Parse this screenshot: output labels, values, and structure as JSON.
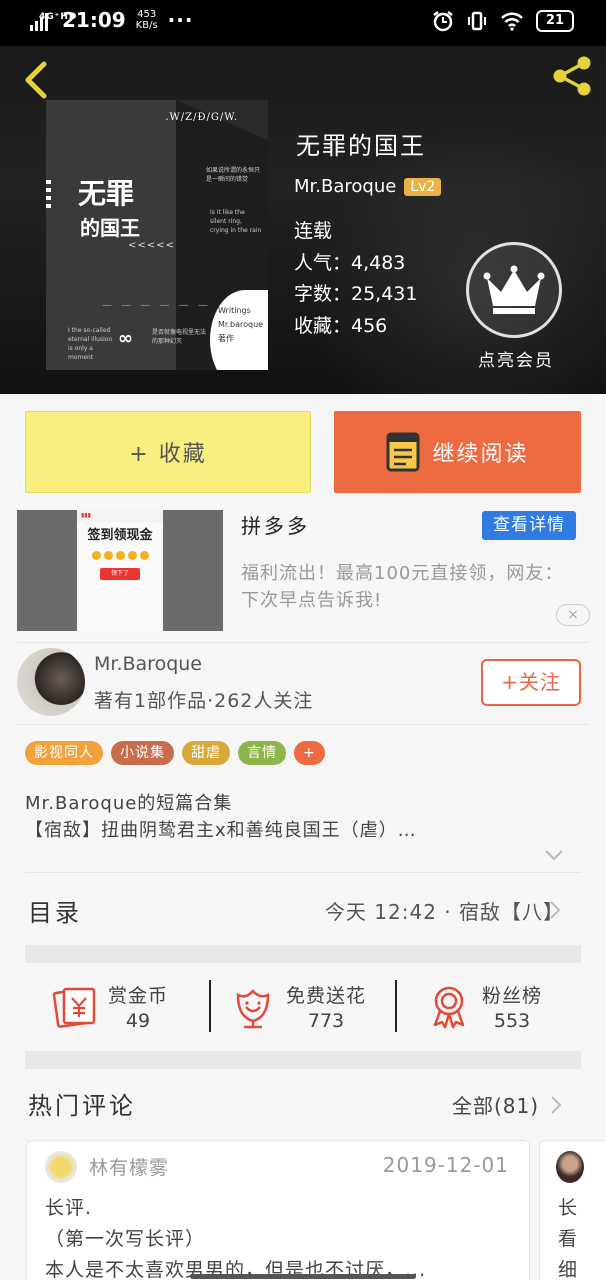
{
  "status_bar": {
    "network": "4G⁺HD",
    "time": "21:09",
    "speed_value": "453",
    "speed_unit": "KB/s",
    "dots": "···",
    "battery": "21"
  },
  "book": {
    "title": "无罪的国王",
    "author": "Mr.Baroque",
    "level": "Lv2",
    "status": "连载",
    "popularity": "人气：4,483",
    "word_count": "字数：25,431",
    "favorites": "收藏：456",
    "vip_label": "点亮会员",
    "cover": {
      "brand": ".W/Z/Ð/G/W.",
      "title_line1": "无罪",
      "title_line2": "的国王",
      "arrows": "<<<<<",
      "cn_note": "如果说所谓的永恒只是一瞬间的错觉",
      "en_note": "Is it like the silent ring, crying in the rain",
      "left_note": "I the so-called eternal illusion is only a moment",
      "infinity": "∞",
      "mid_note": "是否就像电视里无法的那种幻灭",
      "seal_line1": "Writings",
      "seal_line2": "Mr.baroque",
      "seal_line3": "著作"
    }
  },
  "actions": {
    "favorite_label": "+ 收藏",
    "read_label": "继续阅读"
  },
  "ad": {
    "image_title": "签到领现金",
    "image_button": "领下了",
    "title": "拼多多",
    "button": "查看详情",
    "desc": "福利流出！最高100元直接领，网友：下次早点告诉我!",
    "close": "×"
  },
  "author_card": {
    "name": "Mr.Baroque",
    "meta": "著有1部作品·262人关注",
    "follow": "+关注"
  },
  "tags": [
    {
      "label": "影视同人",
      "color": "#f2a23a"
    },
    {
      "label": "小说集",
      "color": "#c86c4c"
    },
    {
      "label": "甜虐",
      "color": "#d9a83a"
    },
    {
      "label": "言情",
      "color": "#8cb64c"
    },
    {
      "label": "+",
      "color": "#ee6a40"
    }
  ],
  "description": {
    "line1": "Mr.Baroque的短篇合集",
    "line2": "【宿敌】扭曲阴鸷君主x和善纯良国王（虐）…"
  },
  "toc": {
    "title": "目录",
    "latest": "今天 12:42 · 宿敌【八】"
  },
  "stats": [
    {
      "label": "赏金币",
      "value": "49",
      "icon": "reward-coin-icon"
    },
    {
      "label": "免费送花",
      "value": "773",
      "icon": "flower-icon"
    },
    {
      "label": "粉丝榜",
      "value": "553",
      "icon": "ribbon-badge-icon"
    }
  ],
  "comments": {
    "title": "热门评论",
    "all_label": "全部(81)",
    "items": [
      {
        "user": "林有檬雾",
        "date": "2019-12-01",
        "line1": "长评.",
        "line2": "（第一次写长评）",
        "line3": "本人是不太喜欢男男的，但是也不讨厌，..."
      }
    ],
    "next_preview": [
      "长",
      "看",
      "细"
    ]
  },
  "colors": {
    "accent_orange": "#ee6a40",
    "favorite_yellow": "#f9ef80",
    "level_gold": "#e7b345",
    "ad_blue": "#2f7be3"
  }
}
